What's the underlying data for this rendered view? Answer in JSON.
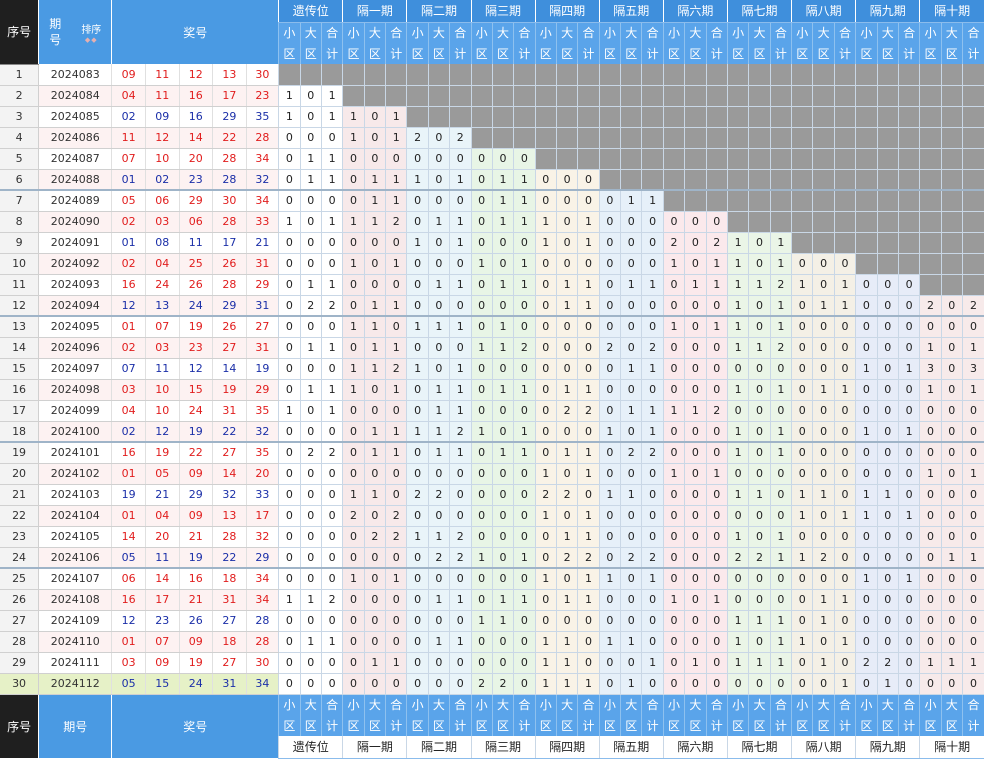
{
  "header": {
    "seq_label": "序号",
    "issue_label_1": "期",
    "issue_label_2": "号",
    "sort_label": "排序",
    "sort_arrows": "◆◆",
    "prize_label": "奖号",
    "groups": [
      "遗传位",
      "隔一期",
      "隔二期",
      "隔三期",
      "隔四期",
      "隔五期",
      "隔六期",
      "隔七期",
      "隔八期",
      "隔九期",
      "隔十期"
    ],
    "sub_small": "小区",
    "sub_big": "大区",
    "sub_total": "合计"
  },
  "footer": {
    "seq_label": "序号",
    "issue_label": "期号",
    "prize_label": "奖号"
  },
  "colors": {
    "blank": "#9a9a9a",
    "group_bg": [
      "#ffffff",
      "#f7e9ea",
      "#e9f4f9",
      "#e8f5e6",
      "#f9f3e7",
      "#e6f0f9",
      "#fbe9ec",
      "#eaf5e7",
      "#f4f0e6",
      "#e7ecf8",
      "#f7eaea"
    ],
    "red_ball": "#e11d1d",
    "blue_ball": "#1b2fa8",
    "highlight_row": "#e6f1c7"
  },
  "rows": [
    {
      "seq": "1",
      "issue": "2024083",
      "nums": [
        "09",
        "11",
        "12",
        "13",
        "30"
      ],
      "vals": []
    },
    {
      "seq": "2",
      "issue": "2024084",
      "nums": [
        "04",
        "11",
        "16",
        "17",
        "23"
      ],
      "vals": [
        "1",
        "0",
        "1"
      ]
    },
    {
      "seq": "3",
      "issue": "2024085",
      "nums": [
        "02",
        "09",
        "16",
        "29",
        "35"
      ],
      "vals": [
        "1",
        "0",
        "1",
        "1",
        "0",
        "1"
      ]
    },
    {
      "seq": "4",
      "issue": "2024086",
      "nums": [
        "11",
        "12",
        "14",
        "22",
        "28"
      ],
      "vals": [
        "0",
        "0",
        "0",
        "1",
        "0",
        "1",
        "2",
        "0",
        "2"
      ]
    },
    {
      "seq": "5",
      "issue": "2024087",
      "nums": [
        "07",
        "10",
        "20",
        "28",
        "34"
      ],
      "vals": [
        "0",
        "1",
        "1",
        "0",
        "0",
        "0",
        "0",
        "0",
        "0",
        "0",
        "0",
        "0"
      ]
    },
    {
      "seq": "6",
      "issue": "2024088",
      "nums": [
        "01",
        "02",
        "23",
        "28",
        "32"
      ],
      "vals": [
        "0",
        "1",
        "1",
        "0",
        "1",
        "1",
        "1",
        "0",
        "1",
        "0",
        "1",
        "1",
        "0",
        "0",
        "0"
      ]
    },
    {
      "seq": "7",
      "issue": "2024089",
      "nums": [
        "05",
        "06",
        "29",
        "30",
        "34"
      ],
      "vals": [
        "0",
        "0",
        "0",
        "0",
        "1",
        "1",
        "0",
        "0",
        "0",
        "0",
        "1",
        "1",
        "0",
        "0",
        "0",
        "0",
        "1",
        "1"
      ]
    },
    {
      "seq": "8",
      "issue": "2024090",
      "nums": [
        "02",
        "03",
        "06",
        "28",
        "33"
      ],
      "vals": [
        "1",
        "0",
        "1",
        "1",
        "1",
        "2",
        "0",
        "1",
        "1",
        "0",
        "1",
        "1",
        "1",
        "0",
        "1",
        "0",
        "0",
        "0",
        "0",
        "0",
        "0"
      ]
    },
    {
      "seq": "9",
      "issue": "2024091",
      "nums": [
        "01",
        "08",
        "11",
        "17",
        "21"
      ],
      "vals": [
        "0",
        "0",
        "0",
        "0",
        "0",
        "0",
        "1",
        "0",
        "1",
        "0",
        "0",
        "0",
        "1",
        "0",
        "1",
        "0",
        "0",
        "0",
        "2",
        "0",
        "2",
        "1",
        "0",
        "1"
      ]
    },
    {
      "seq": "10",
      "issue": "2024092",
      "nums": [
        "02",
        "04",
        "25",
        "26",
        "31"
      ],
      "vals": [
        "0",
        "0",
        "0",
        "1",
        "0",
        "1",
        "0",
        "0",
        "0",
        "1",
        "0",
        "1",
        "0",
        "0",
        "0",
        "0",
        "0",
        "0",
        "1",
        "0",
        "1",
        "1",
        "0",
        "1",
        "0",
        "0",
        "0"
      ]
    },
    {
      "seq": "11",
      "issue": "2024093",
      "nums": [
        "16",
        "24",
        "26",
        "28",
        "29"
      ],
      "vals": [
        "0",
        "1",
        "1",
        "0",
        "0",
        "0",
        "0",
        "1",
        "1",
        "0",
        "1",
        "1",
        "0",
        "1",
        "1",
        "0",
        "1",
        "1",
        "0",
        "1",
        "1",
        "1",
        "1",
        "2",
        "1",
        "0",
        "1",
        "0",
        "0",
        "0"
      ]
    },
    {
      "seq": "12",
      "issue": "2024094",
      "nums": [
        "12",
        "13",
        "24",
        "29",
        "31"
      ],
      "vals": [
        "0",
        "2",
        "2",
        "0",
        "1",
        "1",
        "0",
        "0",
        "0",
        "0",
        "0",
        "0",
        "0",
        "1",
        "1",
        "0",
        "0",
        "0",
        "0",
        "0",
        "0",
        "1",
        "0",
        "1",
        "0",
        "1",
        "1",
        "0",
        "0",
        "0",
        "2",
        "0",
        "2"
      ]
    },
    {
      "seq": "13",
      "issue": "2024095",
      "nums": [
        "01",
        "07",
        "19",
        "26",
        "27"
      ],
      "vals": [
        "0",
        "0",
        "0",
        "1",
        "1",
        "0",
        "1",
        "1",
        "1",
        "0",
        "1",
        "0",
        "0",
        "0",
        "0",
        "0",
        "0",
        "0",
        "1",
        "0",
        "1",
        "1",
        "0",
        "1",
        "0",
        "0",
        "0",
        "0",
        "0",
        "0",
        "0",
        "0",
        "0"
      ]
    },
    {
      "seq": "14",
      "issue": "2024096",
      "nums": [
        "02",
        "03",
        "23",
        "27",
        "31"
      ],
      "vals": [
        "0",
        "1",
        "1",
        "0",
        "1",
        "1",
        "0",
        "0",
        "0",
        "1",
        "1",
        "2",
        "0",
        "0",
        "0",
        "2",
        "0",
        "2",
        "0",
        "0",
        "0",
        "1",
        "1",
        "2",
        "0",
        "0",
        "0",
        "0",
        "0",
        "0",
        "1",
        "0",
        "1"
      ]
    },
    {
      "seq": "15",
      "issue": "2024097",
      "nums": [
        "07",
        "11",
        "12",
        "14",
        "19"
      ],
      "vals": [
        "0",
        "0",
        "0",
        "1",
        "1",
        "2",
        "1",
        "0",
        "1",
        "0",
        "0",
        "0",
        "0",
        "0",
        "0",
        "0",
        "1",
        "1",
        "0",
        "0",
        "0",
        "0",
        "0",
        "0",
        "0",
        "0",
        "0",
        "1",
        "0",
        "1",
        "3",
        "0",
        "3"
      ]
    },
    {
      "seq": "16",
      "issue": "2024098",
      "nums": [
        "03",
        "10",
        "15",
        "19",
        "29"
      ],
      "vals": [
        "0",
        "1",
        "1",
        "1",
        "0",
        "1",
        "0",
        "1",
        "1",
        "0",
        "1",
        "1",
        "0",
        "1",
        "1",
        "0",
        "0",
        "0",
        "0",
        "0",
        "0",
        "1",
        "0",
        "1",
        "0",
        "1",
        "1",
        "0",
        "0",
        "0",
        "1",
        "0",
        "1"
      ]
    },
    {
      "seq": "17",
      "issue": "2024099",
      "nums": [
        "04",
        "10",
        "24",
        "31",
        "35"
      ],
      "vals": [
        "1",
        "0",
        "1",
        "0",
        "0",
        "0",
        "0",
        "1",
        "1",
        "0",
        "0",
        "0",
        "0",
        "2",
        "2",
        "0",
        "1",
        "1",
        "1",
        "1",
        "2",
        "0",
        "0",
        "0",
        "0",
        "0",
        "0",
        "0",
        "0",
        "0",
        "0",
        "0",
        "0"
      ]
    },
    {
      "seq": "18",
      "issue": "2024100",
      "nums": [
        "02",
        "12",
        "19",
        "22",
        "32"
      ],
      "vals": [
        "0",
        "0",
        "0",
        "0",
        "1",
        "1",
        "1",
        "1",
        "2",
        "1",
        "0",
        "1",
        "0",
        "0",
        "0",
        "1",
        "0",
        "1",
        "0",
        "0",
        "0",
        "1",
        "0",
        "1",
        "0",
        "0",
        "0",
        "1",
        "0",
        "1",
        "0",
        "0",
        "0"
      ]
    },
    {
      "seq": "19",
      "issue": "2024101",
      "nums": [
        "16",
        "19",
        "22",
        "27",
        "35"
      ],
      "vals": [
        "0",
        "2",
        "2",
        "0",
        "1",
        "1",
        "0",
        "1",
        "1",
        "0",
        "1",
        "1",
        "0",
        "1",
        "1",
        "0",
        "2",
        "2",
        "0",
        "0",
        "0",
        "1",
        "0",
        "1",
        "0",
        "0",
        "0",
        "0",
        "0",
        "0",
        "0",
        "0",
        "0"
      ]
    },
    {
      "seq": "20",
      "issue": "2024102",
      "nums": [
        "01",
        "05",
        "09",
        "14",
        "20"
      ],
      "vals": [
        "0",
        "0",
        "0",
        "0",
        "0",
        "0",
        "0",
        "0",
        "0",
        "0",
        "0",
        "0",
        "1",
        "0",
        "1",
        "0",
        "0",
        "0",
        "1",
        "0",
        "1",
        "0",
        "0",
        "0",
        "0",
        "0",
        "0",
        "0",
        "0",
        "0",
        "1",
        "0",
        "1"
      ]
    },
    {
      "seq": "21",
      "issue": "2024103",
      "nums": [
        "19",
        "21",
        "29",
        "32",
        "33"
      ],
      "vals": [
        "0",
        "0",
        "0",
        "1",
        "1",
        "0",
        "2",
        "2",
        "0",
        "0",
        "0",
        "0",
        "2",
        "2",
        "0",
        "1",
        "1",
        "0",
        "0",
        "0",
        "0",
        "1",
        "1",
        "0",
        "1",
        "1",
        "0",
        "1",
        "1",
        "0",
        "0",
        "0",
        "0"
      ]
    },
    {
      "seq": "22",
      "issue": "2024104",
      "nums": [
        "01",
        "04",
        "09",
        "13",
        "17"
      ],
      "vals": [
        "0",
        "0",
        "0",
        "2",
        "0",
        "2",
        "0",
        "0",
        "0",
        "0",
        "0",
        "0",
        "1",
        "0",
        "1",
        "0",
        "0",
        "0",
        "0",
        "0",
        "0",
        "0",
        "0",
        "0",
        "1",
        "0",
        "1",
        "1",
        "0",
        "1",
        "0",
        "0",
        "0"
      ]
    },
    {
      "seq": "23",
      "issue": "2024105",
      "nums": [
        "14",
        "20",
        "21",
        "28",
        "32"
      ],
      "vals": [
        "0",
        "0",
        "0",
        "0",
        "2",
        "2",
        "1",
        "1",
        "2",
        "0",
        "0",
        "0",
        "0",
        "1",
        "1",
        "0",
        "0",
        "0",
        "0",
        "0",
        "0",
        "1",
        "0",
        "1",
        "0",
        "0",
        "0",
        "0",
        "0",
        "0",
        "0",
        "0",
        "0"
      ]
    },
    {
      "seq": "24",
      "issue": "2024106",
      "nums": [
        "05",
        "11",
        "19",
        "22",
        "29"
      ],
      "vals": [
        "0",
        "0",
        "0",
        "0",
        "0",
        "0",
        "0",
        "2",
        "2",
        "1",
        "0",
        "1",
        "0",
        "2",
        "2",
        "0",
        "2",
        "2",
        "0",
        "0",
        "0",
        "2",
        "2",
        "1",
        "1",
        "2",
        "0",
        "0",
        "0",
        "0",
        "0",
        "1",
        "1"
      ]
    },
    {
      "seq": "25",
      "issue": "2024107",
      "nums": [
        "06",
        "14",
        "16",
        "18",
        "34"
      ],
      "vals": [
        "0",
        "0",
        "0",
        "1",
        "0",
        "1",
        "0",
        "0",
        "0",
        "0",
        "0",
        "0",
        "1",
        "0",
        "1",
        "1",
        "0",
        "1",
        "0",
        "0",
        "0",
        "0",
        "0",
        "0",
        "0",
        "0",
        "0",
        "1",
        "0",
        "1",
        "0",
        "0",
        "0"
      ]
    },
    {
      "seq": "26",
      "issue": "2024108",
      "nums": [
        "16",
        "17",
        "21",
        "31",
        "34"
      ],
      "vals": [
        "1",
        "1",
        "2",
        "0",
        "0",
        "0",
        "0",
        "1",
        "1",
        "0",
        "1",
        "1",
        "0",
        "1",
        "1",
        "0",
        "0",
        "0",
        "1",
        "0",
        "1",
        "0",
        "0",
        "0",
        "0",
        "1",
        "1",
        "0",
        "0",
        "0",
        "0",
        "0",
        "0"
      ]
    },
    {
      "seq": "27",
      "issue": "2024109",
      "nums": [
        "12",
        "23",
        "26",
        "27",
        "28"
      ],
      "vals": [
        "0",
        "0",
        "0",
        "0",
        "0",
        "0",
        "0",
        "0",
        "0",
        "1",
        "1",
        "0",
        "0",
        "0",
        "0",
        "0",
        "0",
        "0",
        "0",
        "0",
        "0",
        "1",
        "1",
        "1",
        "0",
        "1",
        "0",
        "0",
        "0",
        "0",
        "0",
        "0",
        "0"
      ]
    },
    {
      "seq": "28",
      "issue": "2024110",
      "nums": [
        "01",
        "07",
        "09",
        "18",
        "28"
      ],
      "vals": [
        "0",
        "1",
        "1",
        "0",
        "0",
        "0",
        "0",
        "1",
        "1",
        "0",
        "0",
        "0",
        "1",
        "1",
        "0",
        "1",
        "1",
        "0",
        "0",
        "0",
        "0",
        "1",
        "0",
        "1",
        "1",
        "0",
        "1",
        "0",
        "0",
        "0",
        "0",
        "0",
        "0"
      ]
    },
    {
      "seq": "29",
      "issue": "2024111",
      "nums": [
        "03",
        "09",
        "19",
        "27",
        "30"
      ],
      "vals": [
        "0",
        "0",
        "0",
        "0",
        "1",
        "1",
        "0",
        "0",
        "0",
        "0",
        "0",
        "0",
        "1",
        "1",
        "0",
        "0",
        "0",
        "1",
        "0",
        "1",
        "0",
        "1",
        "1",
        "1",
        "0",
        "1",
        "0",
        "2",
        "2",
        "0",
        "1",
        "1",
        "1"
      ]
    },
    {
      "seq": "30",
      "issue": "2024112",
      "nums": [
        "05",
        "15",
        "24",
        "31",
        "34"
      ],
      "vals": [
        "0",
        "0",
        "0",
        "0",
        "0",
        "0",
        "0",
        "0",
        "0",
        "2",
        "2",
        "0",
        "1",
        "1",
        "1",
        "0",
        "1",
        "0",
        "0",
        "0",
        "0",
        "0",
        "0",
        "0",
        "0",
        "0",
        "1",
        "0",
        "1",
        "0",
        "0",
        "0",
        "0"
      ]
    }
  ]
}
